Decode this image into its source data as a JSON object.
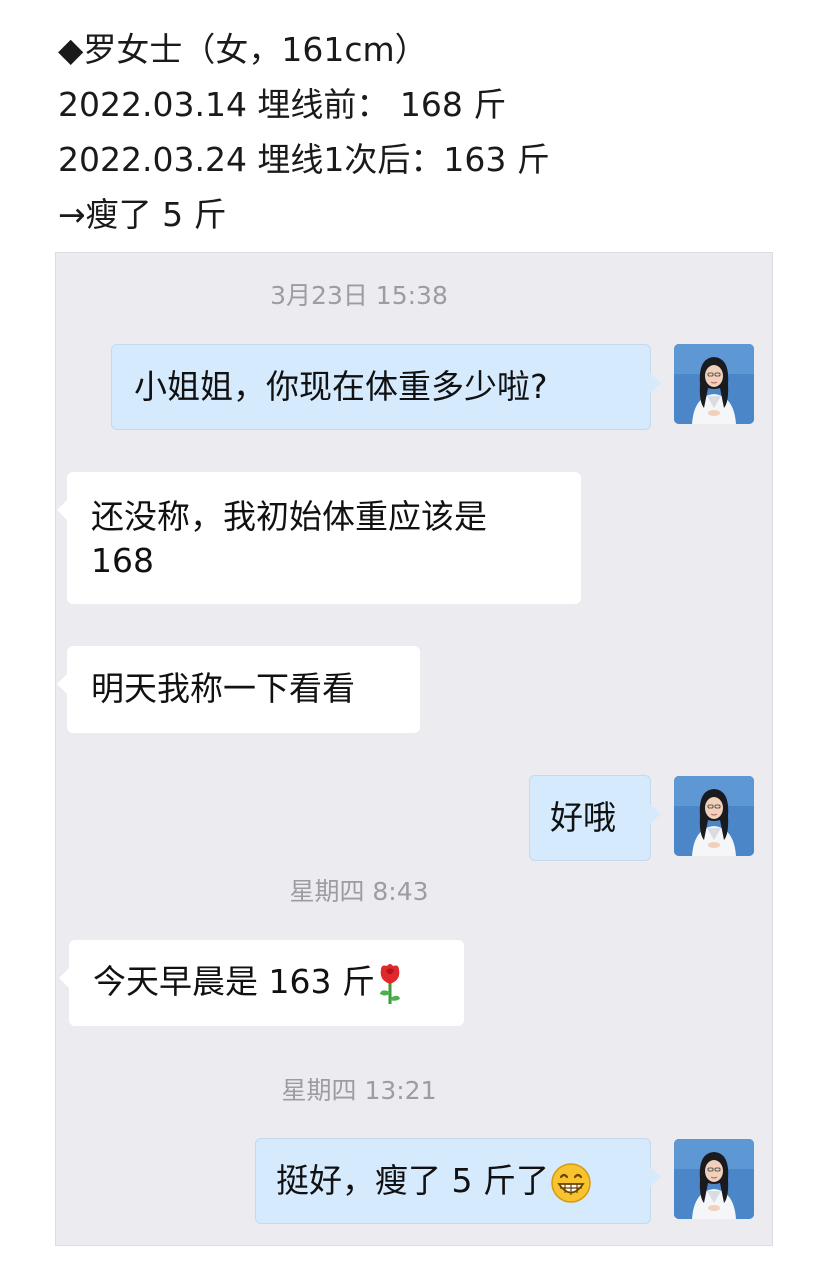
{
  "header": {
    "line1": "◆罗女士（女，161cm）",
    "line2": "2022.03.14 埋线前： 168 斤",
    "line3": "2022.03.24 埋线1次后：163 斤",
    "line4": "→瘦了 5 斤"
  },
  "chat": {
    "background_color": "#ebebf0",
    "outgoing_bubble_color": "#d6eafe",
    "incoming_bubble_color": "#ffffff",
    "timestamps": [
      "3月23日 15:38",
      "星期四 8:43",
      "星期四 13:21"
    ],
    "messages": [
      {
        "side": "right",
        "text": "小姐姐，你现在体重多少啦?"
      },
      {
        "side": "left",
        "text_line1": "还没称，我初始体重应该是",
        "text_line2": "168"
      },
      {
        "side": "left",
        "text": "明天我称一下看看"
      },
      {
        "side": "right",
        "text": "好哦"
      },
      {
        "side": "left",
        "text": "今天早晨是 163 斤",
        "emoji": "rose-emoji"
      },
      {
        "side": "right",
        "text": "挺好，瘦了 5 斤了",
        "emoji": "grinning-face-emoji"
      }
    ],
    "avatar_icon": "doctor-avatar-icon"
  }
}
